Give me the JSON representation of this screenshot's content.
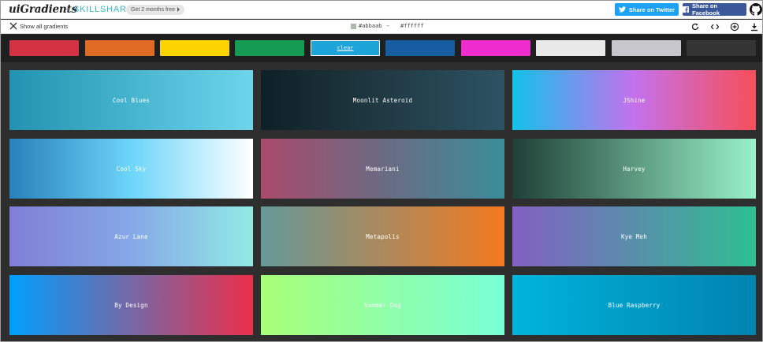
{
  "header": {
    "logo": "uiGradients",
    "plus": "+",
    "partner": "SKILLSHARE",
    "promo": "Get 2 months free",
    "twitter_label": "Share on Twitter",
    "facebook_label": "Share on Facebook",
    "icons": [
      "twitter-icon",
      "facebook-icon",
      "github-icon"
    ]
  },
  "toolbar": {
    "show_all": "Show all gradients",
    "color_a": "#abbaab",
    "arrow": "→",
    "color_b": "#ffffff",
    "icons": [
      "refresh-icon",
      "code-icon",
      "add-icon",
      "download-icon"
    ]
  },
  "filters": [
    {
      "name": "red",
      "color": "#d43343"
    },
    {
      "name": "orange",
      "color": "#e06b25"
    },
    {
      "name": "yellow",
      "color": "#fdd300"
    },
    {
      "name": "green",
      "color": "#169c52"
    },
    {
      "name": "clear",
      "color": "#1da5da",
      "label": "clear"
    },
    {
      "name": "blue",
      "color": "#165da1"
    },
    {
      "name": "pink",
      "color": "#ef2ccd"
    },
    {
      "name": "white",
      "color": "#e9e9e9"
    },
    {
      "name": "grey",
      "color": "#c6c6cc"
    },
    {
      "name": "black",
      "color": "#353535"
    }
  ],
  "gradients": [
    {
      "name": "Cool Blues",
      "from": "#2193b0",
      "to": "#6dd5ed",
      "angle": "to right"
    },
    {
      "name": "Moonlit Asteroid",
      "from": "#0f2027",
      "to": "#2c5364",
      "via": "#203a43",
      "angle": "to right"
    },
    {
      "name": "JShine",
      "from": "#12c2e9",
      "to": "#f64f59",
      "via": "#c471ed",
      "angle": "to right"
    },
    {
      "name": "Cool Sky",
      "from": "#2980b9",
      "to": "#ffffff",
      "via": "#6dd5fa",
      "angle": "to right"
    },
    {
      "name": "Memariani",
      "from": "#aa4b6b",
      "to": "#3b8d99",
      "via": "#6b6b83",
      "angle": "to right"
    },
    {
      "name": "Harvey",
      "from": "#1f4037",
      "to": "#99f2c8",
      "angle": "to right"
    },
    {
      "name": "Azur Lane",
      "from": "#7f7fd5",
      "to": "#91eae4",
      "via": "#86a8e7",
      "angle": "to right"
    },
    {
      "name": "Metapolis",
      "from": "#659999",
      "to": "#f4791f",
      "angle": "to right"
    },
    {
      "name": "Kye Meh",
      "from": "#8360c3",
      "to": "#2ebf91",
      "angle": "to right"
    },
    {
      "name": "By Design",
      "from": "#009fff",
      "to": "#ec2f4b",
      "angle": "to right"
    },
    {
      "name": "Summer Dog",
      "from": "#a8ff78",
      "to": "#78ffd6",
      "angle": "to right"
    },
    {
      "name": "Blue Raspberry",
      "from": "#00b4db",
      "to": "#0083b0",
      "angle": "to right"
    }
  ]
}
